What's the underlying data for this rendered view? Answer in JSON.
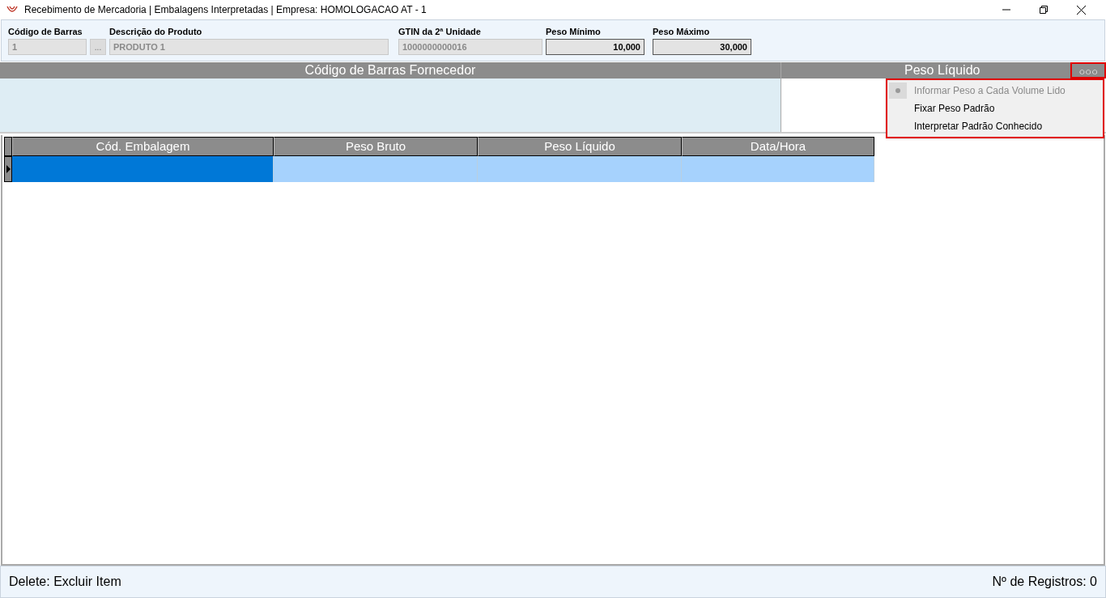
{
  "window": {
    "title": "Recebimento de Mercadoria | Embalagens Interpretadas | Empresa: HOMOLOGACAO AT - 1"
  },
  "fields": {
    "barcode": {
      "label": "Código de Barras",
      "value": "1",
      "lookup": "..."
    },
    "description": {
      "label": "Descrição do Produto",
      "value": "PRODUTO 1"
    },
    "gtin": {
      "label": "GTIN da 2ª Unidade",
      "value": "1000000000016"
    },
    "min_weight": {
      "label": "Peso Mínimo",
      "value": "10,000"
    },
    "max_weight": {
      "label": "Peso Máximo",
      "value": "30,000"
    }
  },
  "scan_panel": {
    "barcode_header": "Código de Barras Fornecedor",
    "weight_header": "Peso Líquido",
    "options_button": "○○○"
  },
  "options_menu": [
    {
      "label": "Informar Peso a Cada Volume Lido",
      "selected": true,
      "disabled": true
    },
    {
      "label": "Fixar Peso Padrão",
      "selected": false,
      "disabled": false
    },
    {
      "label": "Interpretar Padrão Conhecido",
      "selected": false,
      "disabled": false
    }
  ],
  "table": {
    "columns": [
      "Cód. Embalagem",
      "Peso Bruto",
      "Peso Líquido",
      "Data/Hora"
    ],
    "rows": [
      {
        "cells": [
          "",
          "",
          "",
          ""
        ],
        "selected": true
      }
    ]
  },
  "status_bar": {
    "hint": "Delete: Excluir Item",
    "count": "Nº de Registros: 0"
  }
}
